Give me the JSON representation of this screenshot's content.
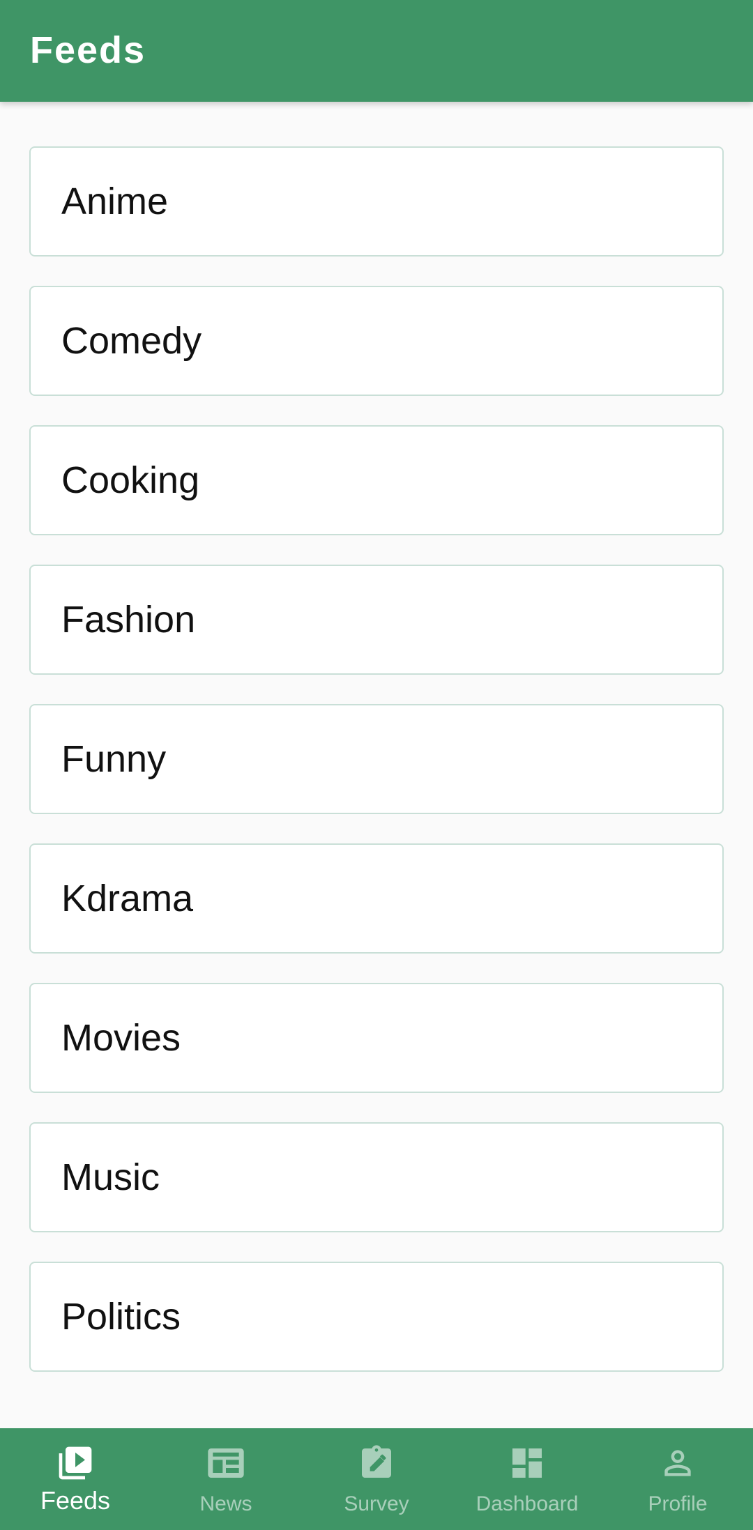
{
  "appbar": {
    "title": "Feeds"
  },
  "feeds": [
    {
      "label": "Anime"
    },
    {
      "label": "Comedy"
    },
    {
      "label": "Cooking"
    },
    {
      "label": "Fashion"
    },
    {
      "label": "Funny"
    },
    {
      "label": "Kdrama"
    },
    {
      "label": "Movies"
    },
    {
      "label": "Music"
    },
    {
      "label": "Politics"
    }
  ],
  "bottom_nav": {
    "active": "Feeds",
    "items": [
      {
        "label": "Feeds",
        "icon": "video-library-icon"
      },
      {
        "label": "News",
        "icon": "newspaper-icon"
      },
      {
        "label": "Survey",
        "icon": "survey-clipboard-icon"
      },
      {
        "label": "Dashboard",
        "icon": "dashboard-icon"
      },
      {
        "label": "Profile",
        "icon": "person-icon"
      }
    ]
  },
  "colors": {
    "primary": "#3f9566",
    "card_border": "#c9dfd7",
    "background": "#fafafa"
  }
}
